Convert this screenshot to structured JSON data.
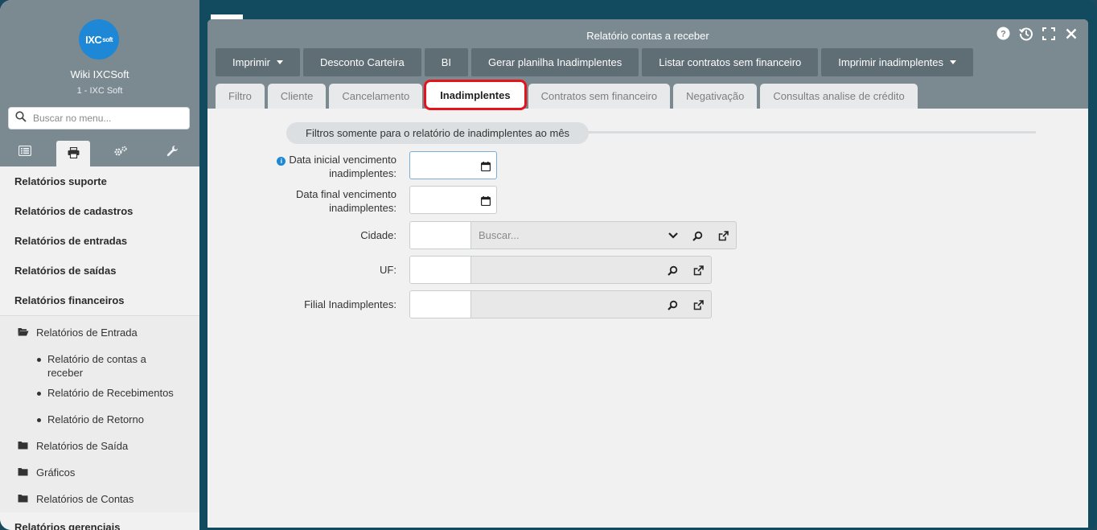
{
  "sidebar": {
    "logo_text": "IXC",
    "logo_suffix": "soft",
    "app_name": "Wiki IXCSoft",
    "app_sub": "1 - IXC Soft",
    "search_placeholder": "Buscar no menu...",
    "tabs": [
      "list-icon",
      "print-icon",
      "cogs-icon",
      "wrench-icon"
    ],
    "headers": [
      "Relatórios suporte",
      "Relatórios de cadastros",
      "Relatórios de entradas",
      "Relatórios de saídas",
      "Relatórios financeiros"
    ],
    "folder_open": "Relatórios de Entrada",
    "leaves": [
      "Relatório de contas a receber",
      "Relatório de Recebimentos",
      "Relatório de Retorno"
    ],
    "folders": [
      "Relatórios de Saída",
      "Gráficos",
      "Relatórios de Contas"
    ],
    "last_header": "Relatórios gerenciais"
  },
  "window": {
    "title": "Relatório contas a receber",
    "toolbar": [
      {
        "label": "Imprimir",
        "dropdown": true
      },
      {
        "label": "Desconto Carteira",
        "dropdown": false
      },
      {
        "label": "BI",
        "dropdown": false
      },
      {
        "label": "Gerar planilha Inadimplentes",
        "dropdown": false
      },
      {
        "label": "Listar contratos sem financeiro",
        "dropdown": false
      },
      {
        "label": "Imprimir inadimplentes",
        "dropdown": true
      }
    ],
    "tabs": [
      "Filtro",
      "Cliente",
      "Cancelamento",
      "Inadimplentes",
      "Contratos sem financeiro",
      "Negativação",
      "Consultas analise de crédito"
    ],
    "active_tab": "Inadimplentes"
  },
  "form": {
    "section_title": "Filtros somente para o relatório de inadimplentes ao mês",
    "date_start_label_1": "Data inicial vencimento",
    "date_start_label_2": "inadimplentes:",
    "date_end_label_1": "Data final vencimento",
    "date_end_label_2": "inadimplentes:",
    "cidade_label": "Cidade:",
    "cidade_placeholder": "Buscar...",
    "uf_label": "UF:",
    "filial_label": "Filial Inadimplentes:"
  },
  "colors": {
    "header_bg": "#7b8a91",
    "button_bg": "#5f6d74",
    "active_tab_outline": "#e3141b",
    "logo_blue": "#1e88d6"
  }
}
